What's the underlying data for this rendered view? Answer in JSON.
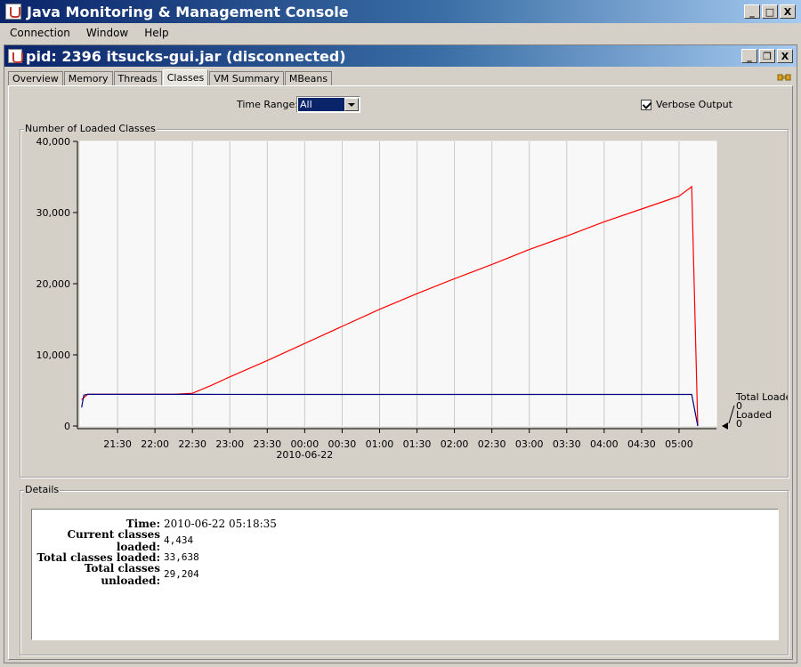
{
  "window": {
    "title": "Java Monitoring & Management Console",
    "controls": {
      "minimize": "_",
      "maximize": "□",
      "close": "X"
    }
  },
  "menu": [
    "Connection",
    "Window",
    "Help"
  ],
  "connection": {
    "title": "pid: 2396 itsucks-gui.jar (disconnected)",
    "controls": {
      "minimize": "_",
      "restore": "❐",
      "close": "X"
    }
  },
  "tabs": [
    "Overview",
    "Memory",
    "Threads",
    "Classes",
    "VM Summary",
    "MBeans"
  ],
  "active_tab": "Classes",
  "toolbar": {
    "time_range_label": "Time Range:",
    "time_range_value": "All",
    "verbose_label": "Verbose Output",
    "verbose_checked": true
  },
  "chart_panel_title": "Number of Loaded Classes",
  "chart_data": {
    "type": "line",
    "x_tick_labels": [
      "21:30",
      "22:00",
      "22:30",
      "23:00",
      "23:30",
      "00:00",
      "00:30",
      "01:00",
      "01:30",
      "02:00",
      "02:30",
      "03:00",
      "03:30",
      "04:00",
      "04:30",
      "05:00"
    ],
    "x_date_label": "2010-06-22",
    "y_tick_labels": [
      "40,000",
      "30,000",
      "20,000",
      "10,000",
      "0"
    ],
    "ylim": [
      0,
      40000
    ],
    "x_hours_range": [
      21.0,
      5.5
    ],
    "series": [
      {
        "name": "Total Loaded",
        "color": "#ff0000",
        "x": [
          21.02,
          21.1,
          22.25,
          22.5,
          22.75,
          23.0,
          23.5,
          24.0,
          24.5,
          25.0,
          25.5,
          26.0,
          26.5,
          27.0,
          27.5,
          28.0,
          28.5,
          29.0,
          29.17,
          29.25
        ],
        "values": [
          3700,
          4450,
          4450,
          4600,
          5700,
          6900,
          9200,
          11600,
          14000,
          16400,
          18600,
          20700,
          22700,
          24800,
          26700,
          28700,
          30500,
          32300,
          33638,
          0
        ]
      },
      {
        "name": "Loaded",
        "color": "#000080",
        "x": [
          21.02,
          21.05,
          21.1,
          22.5,
          23.5,
          25.0,
          26.5,
          28.0,
          29.0,
          29.17,
          29.25
        ],
        "values": [
          2600,
          4350,
          4450,
          4450,
          4434,
          4434,
          4434,
          4434,
          4434,
          4434,
          0
        ]
      }
    ],
    "legend": [
      {
        "name": "Total Loaded",
        "value": "0"
      },
      {
        "name": "Loaded",
        "value": "0"
      }
    ],
    "grid": true,
    "legend_position": "right"
  },
  "details": {
    "title": "Details",
    "rows": [
      {
        "key": "Time:",
        "value": "2010-06-22 05:18:35"
      },
      {
        "key": "Current classes loaded:",
        "value": "4,434"
      },
      {
        "key": "Total classes loaded:",
        "value": "33,638"
      },
      {
        "key": "Total classes unloaded:",
        "value": "29,204"
      }
    ]
  }
}
